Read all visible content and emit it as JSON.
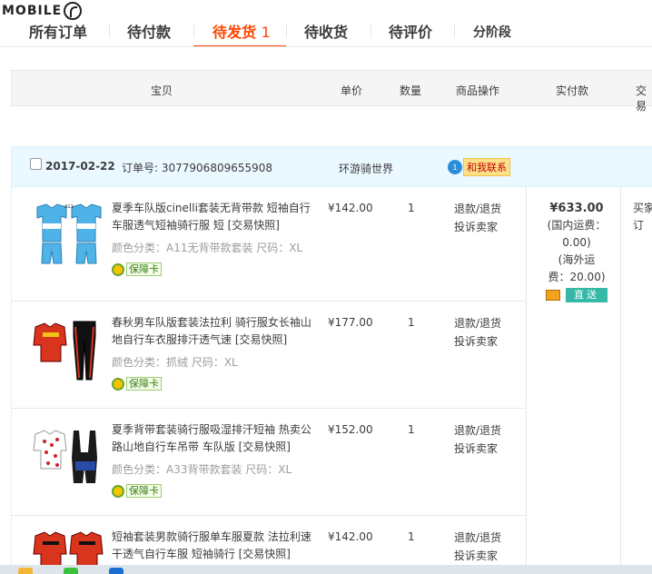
{
  "logo": {
    "text": "MOBILE"
  },
  "tabs": [
    {
      "label": "所有订单"
    },
    {
      "label": "待付款"
    },
    {
      "label": "待发货",
      "count": "1"
    },
    {
      "label": "待收货"
    },
    {
      "label": "待评价"
    },
    {
      "label": "分阶段"
    }
  ],
  "table_header": [
    "宝贝",
    "单价",
    "数量",
    "商品操作",
    "实付款",
    "交易"
  ],
  "order": {
    "date": "2017-02-22",
    "order_no_label": "订单号:",
    "order_no": "3077906809655908",
    "shop": "环游骑世界",
    "contact_badge": "1",
    "contact_label": "和我联系",
    "items": [
      {
        "title": "夏季车队版cinelli套装无背带款 短袖自行车服透气短袖骑行服 短 [交易快照]",
        "sku": "颜色分类：A11无背带款套装  尺码：XL",
        "guarantee": "保障卡",
        "price": "¥142.00",
        "qty": "1",
        "ops": [
          "退款/退货",
          "投诉卖家"
        ]
      },
      {
        "title": "春秋男车队版套装法拉利 骑行服女长袖山地自行车衣服排汗透气速 [交易快照]",
        "sku": "颜色分类：抓绒  尺码：XL",
        "guarantee": "保障卡",
        "price": "¥177.00",
        "qty": "1",
        "ops": [
          "退款/退货",
          "投诉卖家"
        ]
      },
      {
        "title": "夏季背带套装骑行服吸湿排汗短袖 热卖公路山地自行车吊带 车队版 [交易快照]",
        "sku": "颜色分类：A33背带款套装  尺码：XL",
        "guarantee": "保障卡",
        "price": "¥152.00",
        "qty": "1",
        "ops": [
          "退款/退货",
          "投诉卖家"
        ]
      },
      {
        "title": "短袖套装男款骑行服单车服夏款 法拉利速干透气自行车服 短袖骑行 [交易快照]",
        "price": "¥142.00",
        "qty": "1",
        "ops": [
          "退款/退货",
          "投诉卖家"
        ]
      }
    ],
    "payment": {
      "total": "¥633.00",
      "domestic_shipping": "(国内运费：0.00)",
      "overseas_shipping_1": "(海外运",
      "overseas_shipping_2": "费：20.00)",
      "direct_label": "直送"
    },
    "trade_status": [
      "买家",
      "订"
    ]
  },
  "colors": {
    "accent": "#ff4400",
    "order_head_bg": "#eaf8ff",
    "direct_badge": "#35b8a8"
  }
}
